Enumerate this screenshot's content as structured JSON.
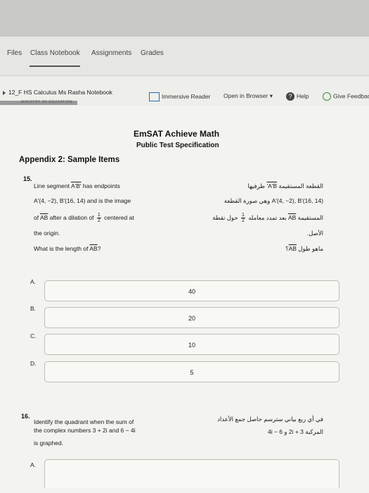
{
  "nav": {
    "tabs": [
      "Files",
      "Class Notebook",
      "Assignments",
      "Grades"
    ]
  },
  "notebook": {
    "breadcrumb": "12_F HS Calculus Ms Rasha Notebook"
  },
  "toolbar": {
    "immersive_reader": "Immersive Reader",
    "open_in_browser": "Open in Browser",
    "help": "Help",
    "give_feedback": "Give Feedbac"
  },
  "page": {
    "strip_text": "MINISTRY OF EDUCATION",
    "title": "EmSAT Achieve Math",
    "subtitle": "Public Test Specification",
    "appendix": "Appendix 2: Sample Items"
  },
  "q15": {
    "number": "15.",
    "en1a": "Line segment ",
    "en1b": "A'B'",
    "en1c": " has endpoints",
    "en2": "A'(4, −2), B'(16, 14) and is the image",
    "en3a": "of ",
    "en3b": "AB",
    "en3c": " after a dilation of ",
    "en3d": " centered at",
    "frac_n": "1",
    "frac_d": "2",
    "en4": "the origin.",
    "en5a": "What is the length of ",
    "en5b": "AB",
    "en5c": "?",
    "ar1a": "القطعة المستقيمة ",
    "ar1b": "A'B'",
    "ar1c": " طرفيها",
    "ar2": "A'(4, −2), B'(16, 14) وهي صورة القطعة",
    "ar3a": "المستقيمة ",
    "ar3b": "AB",
    "ar3c": " بعد تمدد معامله ",
    "ar3d": " حول نقطة",
    "ar4": "الأصل.",
    "ar5a": "ماهو طول ",
    "ar5b": "AB",
    "ar5c": "؟",
    "options": [
      {
        "label": "A.",
        "value": "40"
      },
      {
        "label": "B.",
        "value": "20"
      },
      {
        "label": "C.",
        "value": "10"
      },
      {
        "label": "D.",
        "value": "5"
      }
    ]
  },
  "q16": {
    "number": "16.",
    "en1": "Identify the quadrant when the sum of",
    "en2": "the complex numbers 3 + 2i and 6 − 4i",
    "en3": "is graphed.",
    "ar1": "في أي ربع بياني سترسم حاصل جمع الأعداد",
    "ar2": "المركبة 3 + 2i و 6 − 4i",
    "option_a_label": "A."
  }
}
